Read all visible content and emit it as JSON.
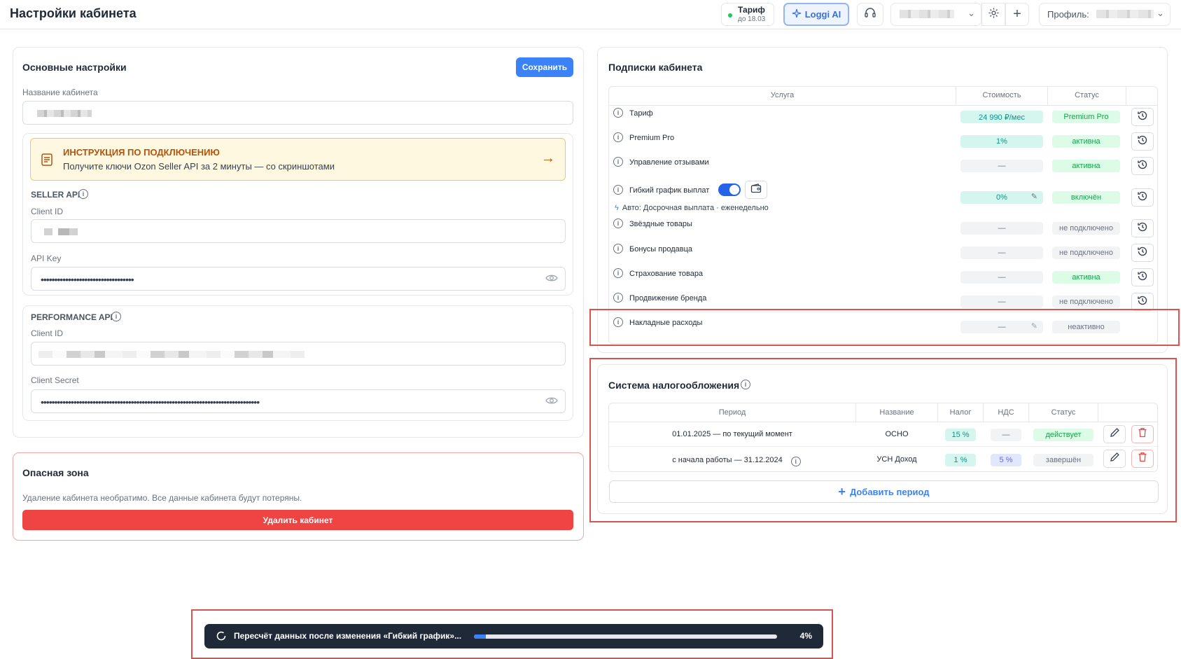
{
  "header": {
    "title": "Настройки кабинета",
    "tariff_label": "Тариф",
    "tariff_until": "до 18.03",
    "loggi_label": "Loggi AI",
    "profile_label": "Профиль:"
  },
  "basic": {
    "title": "Основные настройки",
    "save_label": "Сохранить",
    "cabinet_name_label": "Название кабинета",
    "instruction_title": "ИНСТРУКЦИЯ ПО ПОДКЛЮЧЕНИЮ",
    "instruction_text": "Получите ключи Ozon Seller API за 2 минуты — со скриншотами",
    "seller_api_caption": "SELLER API",
    "seller_client_id_label": "Client ID",
    "api_key_label": "API Key",
    "api_key_value": "••••••••••••••••••••••••••••••••••",
    "performance_caption": "PERFORMANCE API",
    "perf_client_id_label": "Client ID",
    "client_secret_label": "Client Secret",
    "client_secret_value": "••••••••••••••••••••••••••••••••••••••••••••••••••••••••••••••••••••••••••••••••"
  },
  "danger": {
    "title": "Опасная зона",
    "text": "Удаление кабинета необратимо. Все данные кабинета будут потеряны.",
    "delete_label": "Удалить кабинет"
  },
  "subscriptions": {
    "title": "Подписки кабинета",
    "col_service": "Услуга",
    "col_cost": "Стоимость",
    "col_status": "Статус",
    "rows": [
      {
        "name": "Тариф",
        "cost": "24 990 ₽/мес",
        "status": "Premium Pro"
      },
      {
        "name": "Premium Pro",
        "cost": "1%",
        "status": "активна"
      },
      {
        "name": "Управление отзывами",
        "cost": "—",
        "status": "активна"
      },
      {
        "name": "Гибкий график выплат",
        "cost": "0%",
        "status": "включён",
        "sub": "Авто: Досрочная выплата · еженедельно"
      },
      {
        "name": "Звёздные товары",
        "cost": "—",
        "status": "не подключено"
      },
      {
        "name": "Бонусы продавца",
        "cost": "—",
        "status": "не подключено"
      },
      {
        "name": "Страхование товара",
        "cost": "—",
        "status": "активна"
      },
      {
        "name": "Продвижение бренда",
        "cost": "—",
        "status": "не подключено"
      },
      {
        "name": "Накладные расходы",
        "cost": "—",
        "status": "неактивно"
      }
    ]
  },
  "tax": {
    "title": "Система налогообложения",
    "col_period": "Период",
    "col_name": "Название",
    "col_tax": "Налог",
    "col_vat": "НДС",
    "col_status": "Статус",
    "rows": [
      {
        "period": "01.01.2025 — по текущий момент",
        "name": "ОСНО",
        "tax": "15 %",
        "vat": "—",
        "status": "действует"
      },
      {
        "period": "с начала работы — 31.12.2024",
        "name": "УСН Доход",
        "tax": "1 %",
        "vat": "5 %",
        "status": "завершён"
      }
    ],
    "add_label": "Добавить период"
  },
  "progress": {
    "text": "Пересчёт данных после изменения «Гибкий график»...",
    "percent_label": "4%",
    "value": 0.04
  },
  "colors": {
    "accent": "#3b82f6",
    "danger": "#ef4444",
    "highlight": "#d9534f"
  }
}
